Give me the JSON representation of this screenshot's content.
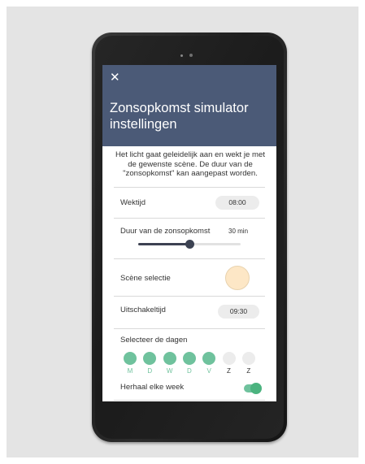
{
  "header": {
    "close_glyph": "✕",
    "title": "Zonsopkomst simulator instellingen"
  },
  "description": "Het licht gaat geleidelijk aan en wekt je met de gewenste scène. De duur van de \"zonsopkomst\" kan aangepast worden.",
  "wake_time": {
    "label": "Wektijd",
    "value": "08:00"
  },
  "sunrise_duration": {
    "label": "Duur van de zonsopkomst",
    "value": "30 min",
    "slider_fraction": 0.5
  },
  "scene": {
    "label": "Scène selectie",
    "swatch_color": "#fde7c6"
  },
  "off_time": {
    "label": "Uitschakeltijd",
    "value": "09:30"
  },
  "days": {
    "label": "Selecteer de dagen",
    "items": [
      {
        "letter": "M",
        "selected": true
      },
      {
        "letter": "D",
        "selected": true
      },
      {
        "letter": "W",
        "selected": true
      },
      {
        "letter": "D",
        "selected": true
      },
      {
        "letter": "V",
        "selected": true
      },
      {
        "letter": "Z",
        "selected": false
      },
      {
        "letter": "Z",
        "selected": false
      }
    ]
  },
  "repeat": {
    "label": "Herhaal elke week",
    "enabled": true
  },
  "colors": {
    "header": "#4b5a77",
    "accent": "#6fc29d",
    "slider": "#3c4252"
  }
}
